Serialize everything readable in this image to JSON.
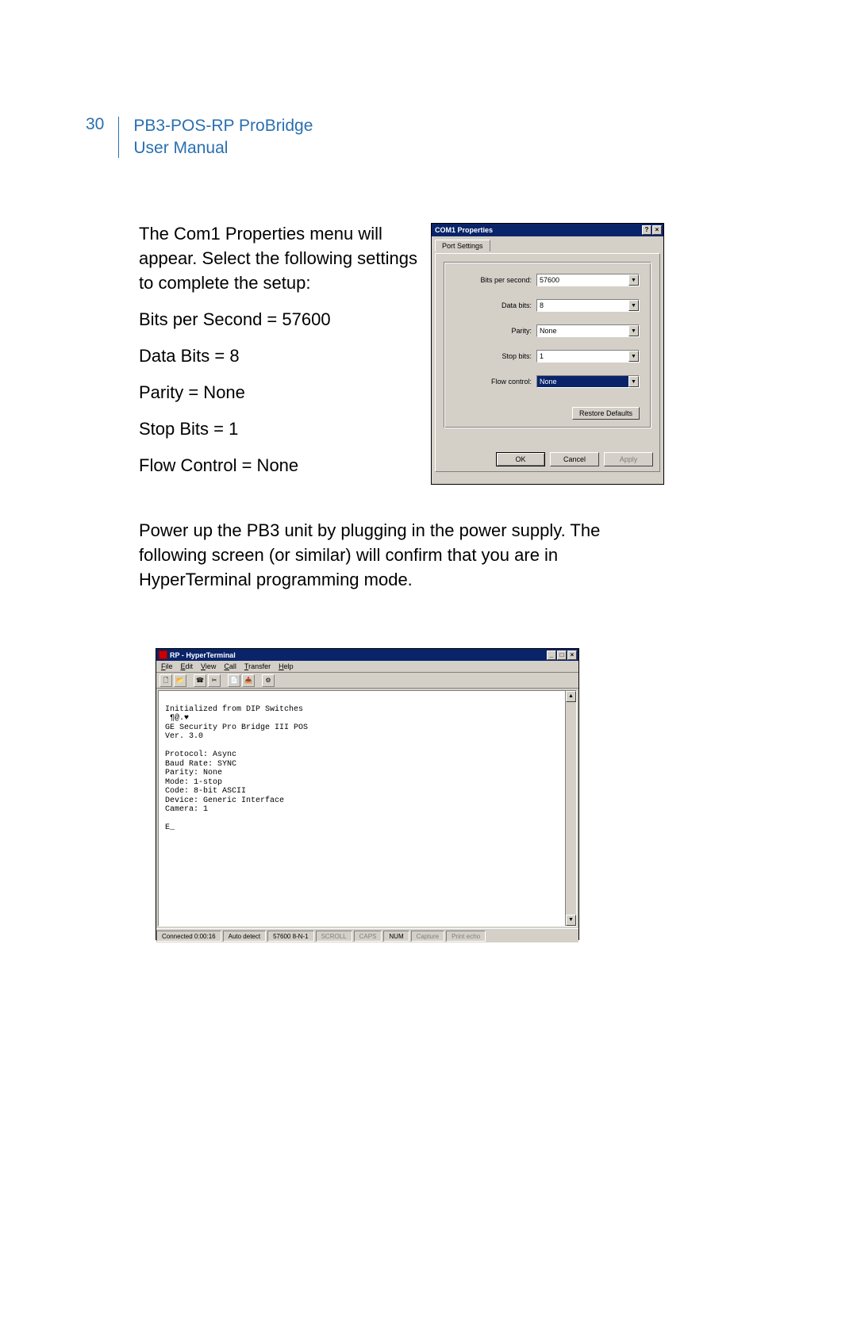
{
  "header": {
    "page_number": "30",
    "title_line1": "PB3-POS-RP ProBridge",
    "title_line2": "User Manual"
  },
  "body": {
    "para1": "The Com1 Properties menu will appear.  Select the following settings to complete the setup:",
    "line_bps": "Bits per Second = 57600",
    "line_db": "Data Bits = 8",
    "line_par": "Parity = None",
    "line_sb": "Stop Bits = 1",
    "line_fc": "Flow Control = None",
    "para2": "Power up the PB3 unit by plugging in the power supply. The following screen (or similar) will confirm that you are in HyperTerminal programming mode."
  },
  "com1": {
    "title": "COM1 Properties",
    "help_btn": "?",
    "close_btn": "×",
    "tab": "Port Settings",
    "fields": {
      "bps_label": "Bits per second:",
      "bps_value": "57600",
      "db_label": "Data bits:",
      "db_value": "8",
      "par_label": "Parity:",
      "par_value": "None",
      "sb_label": "Stop bits:",
      "sb_value": "1",
      "fc_label": "Flow control:",
      "fc_value": "None"
    },
    "restore": "Restore Defaults",
    "ok": "OK",
    "cancel": "Cancel",
    "apply": "Apply"
  },
  "ht": {
    "title": "RP - HyperTerminal",
    "min_btn": "_",
    "max_btn": "□",
    "close_btn": "×",
    "menu": {
      "file": "File",
      "edit": "Edit",
      "view": "View",
      "call": "Call",
      "transfer": "Transfer",
      "help": "Help"
    },
    "terminal_text": "\nInitialized from DIP Switches\n ¶@.♥\nGE Security Pro Bridge III POS\nVer. 3.0\n\nProtocol: Async\nBaud Rate: SYNC\nParity: None\nMode: 1-stop\nCode: 8-bit ASCII\nDevice: Generic Interface\nCamera: 1\n\nE_",
    "status": {
      "conn": "Connected 0:00:16",
      "auto": "Auto detect",
      "baud": "57600 8-N-1",
      "scroll": "SCROLL",
      "caps": "CAPS",
      "num": "NUM",
      "capture": "Capture",
      "echo": "Print echo"
    }
  }
}
